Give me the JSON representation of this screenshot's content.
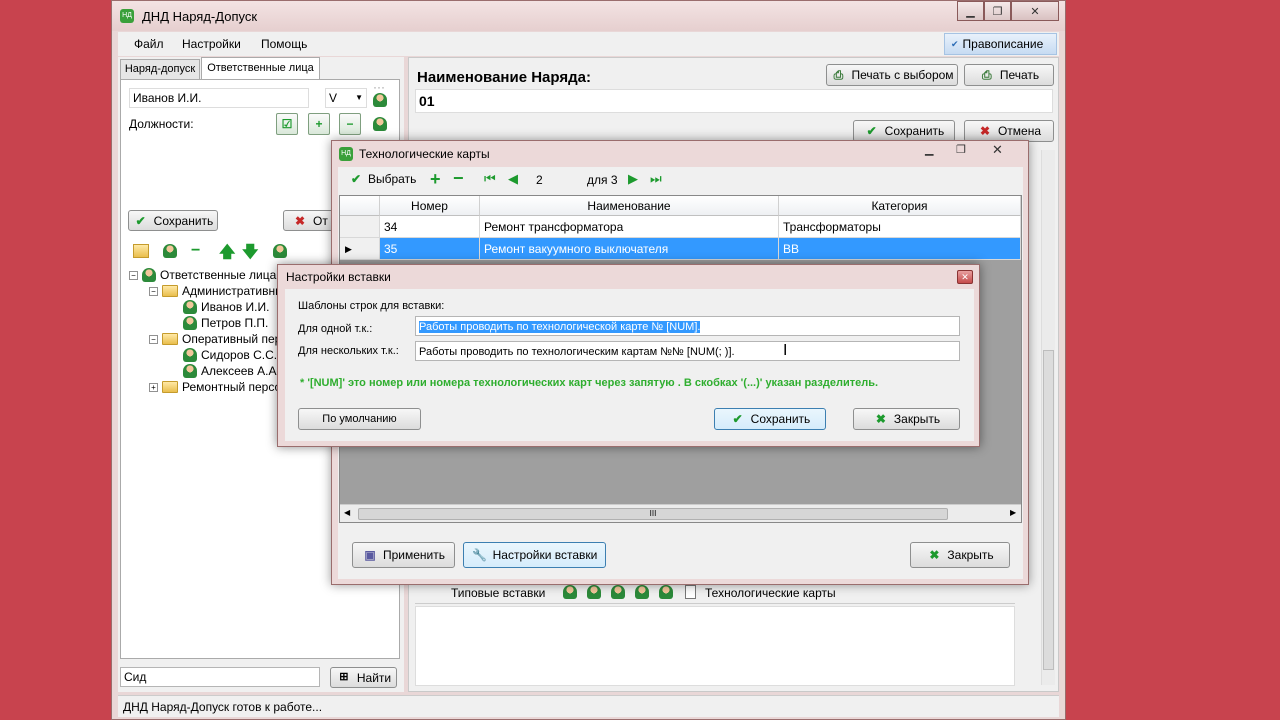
{
  "main_window": {
    "title": "ДНД Наряд-Допуск",
    "menu": [
      "Файл",
      "Настройки",
      "Помощь"
    ],
    "spellcheck_label": "Правописание",
    "status_text": "ДНД Наряд-Допуск готов к работе..."
  },
  "left_panel": {
    "tabs": [
      "Наряд-допуск",
      "Ответственные лица"
    ],
    "person_value": "Иванов И.И.",
    "group_value": "V",
    "positions_label": "Должности:",
    "save_label": "Сохранить",
    "cancel_label_partial": "От",
    "tree": {
      "root": "Ответственные лица",
      "groups": [
        {
          "label": "Административны",
          "members": [
            "Иванов И.И.",
            "Петров П.П."
          ]
        },
        {
          "label": "Оперативный пер",
          "members": [
            "Сидоров С.С.",
            "Алексеев А.А."
          ]
        },
        {
          "label": "Ремонтный персо",
          "members": []
        }
      ]
    },
    "search_value": "Сид",
    "find_label": "Найти"
  },
  "right_panel": {
    "order_name_label": "Наименование Наряда:",
    "order_name_value": "01",
    "print_with_choice_label": "Печать с выбором",
    "print_label": "Печать",
    "save_label": "Сохранить",
    "cancel_label": "Отмена",
    "bottom_tabs": [
      "Типовые вставки",
      "Технологические карты"
    ]
  },
  "tech_cards": {
    "title": "Технологические карты",
    "select_label": "Выбрать",
    "page_value": "2",
    "page_of": "для 3",
    "columns": [
      "Номер",
      "Наименование",
      "Категория"
    ],
    "rows": [
      {
        "num": "34",
        "name": "Ремонт трансформатора",
        "cat": "Трансформаторы",
        "selected": false
      },
      {
        "num": "35",
        "name": "Ремонт вакуумного выключателя",
        "cat": "ВВ",
        "selected": true
      }
    ],
    "scroll_mark": "III",
    "apply_label": "Применить",
    "insert_settings_label": "Настройки вставки",
    "close_label": "Закрыть"
  },
  "insert_settings": {
    "title": "Настройки вставки",
    "section_label": "Шаблоны строк для вставки:",
    "single_label": "Для одной т.к.:",
    "single_value": "Работы проводить по технологической карте № [NUM].",
    "multi_label": "Для нескольких т.к.:",
    "multi_value": "Работы проводить по технологическим картам №№ [NUM(; )].",
    "hint": "* '[NUM]' это номер или номера технологических карт через запятую . В скобках '(...)' указан разделитель.",
    "default_label": "По умолчанию",
    "save_label": "Сохранить",
    "close_label": "Закрыть"
  },
  "colors": {
    "desktop": "#c8434e",
    "selection": "#3399ff",
    "hint_green": "#2fae2f"
  }
}
